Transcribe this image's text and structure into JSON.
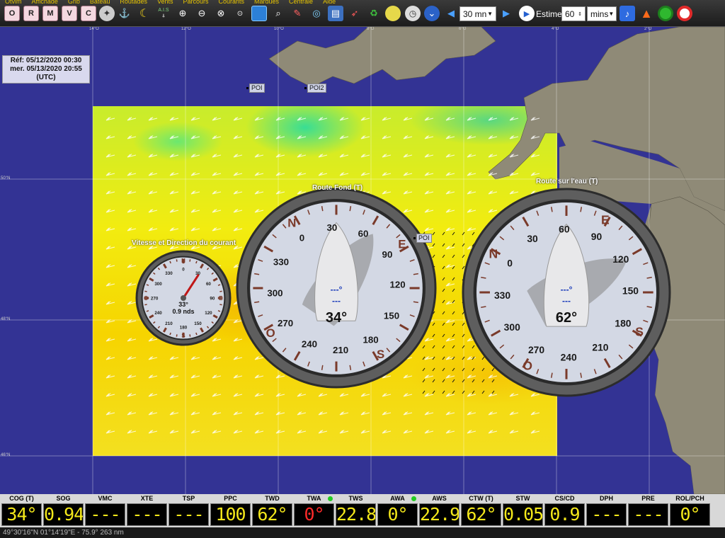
{
  "menu": [
    "Qtvlm",
    "Affichage",
    "Grib",
    "Bateau",
    "Routages",
    "Vents",
    "Parcours",
    "Courants",
    "Marques",
    "Centrale",
    "Aide"
  ],
  "toolbar": {
    "toggles": [
      "O",
      "R",
      "M",
      "V",
      "C"
    ],
    "ais_label": "A.I.S",
    "time_step": "30 mn",
    "estime_label": "Estime",
    "estime_value": "60",
    "estime_unit": "mins"
  },
  "map": {
    "ref_line1": "Réf: 05/12/2020 00:30",
    "ref_line2": "mer. 05/13/2020 20:55",
    "ref_line3": "(UTC)",
    "poi": [
      "POI",
      "POI2",
      "POI"
    ],
    "lat_labels": [
      "50°N",
      "48°N",
      "46°N"
    ],
    "lon_labels": [
      "14°O",
      "12°O",
      "10°O",
      "8°O",
      "6°O",
      "4°O",
      "2°O"
    ]
  },
  "gauges": {
    "current": {
      "title": "Vitesse et Direction du courant",
      "cardinals": [
        "N",
        "E",
        "S",
        "O"
      ],
      "ticks": [
        "0",
        "30",
        "60",
        "90",
        "120",
        "150",
        "180",
        "210",
        "240",
        "270",
        "300",
        "330"
      ],
      "angle_text": "33°",
      "speed_text": "0.9 nds",
      "direction": 33
    },
    "cog": {
      "title": "Route Fond (T)",
      "cardinals": [
        "N",
        "E",
        "S",
        "O"
      ],
      "ticks": [
        "0",
        "30",
        "60",
        "90",
        "120",
        "150",
        "180",
        "210",
        "240",
        "270",
        "300",
        "330"
      ],
      "small1": "---°",
      "small2": "---",
      "value": "34°",
      "heading": 34
    },
    "ctw": {
      "title": "Route sur l'eau (T)",
      "cardinals": [
        "N",
        "E",
        "S",
        "O"
      ],
      "ticks": [
        "0",
        "30",
        "60",
        "90",
        "120",
        "150",
        "180",
        "210",
        "240",
        "270",
        "300",
        "330"
      ],
      "small1": "---°",
      "small2": "---",
      "value": "62°",
      "heading": 62
    }
  },
  "instruments": [
    {
      "label": "COG (T)",
      "value": "34°"
    },
    {
      "label": "SOG",
      "value": "0.94"
    },
    {
      "label": "VMC",
      "value": "----"
    },
    {
      "label": "XTE",
      "value": "----"
    },
    {
      "label": "TSP",
      "value": "----"
    },
    {
      "label": "PPC",
      "value": "100"
    },
    {
      "label": "TWD",
      "value": "62°"
    },
    {
      "label": "TWA",
      "value": "0°",
      "color": "red",
      "dot": true
    },
    {
      "label": "TWS",
      "value": "22.8"
    },
    {
      "label": "AWA",
      "value": "0°",
      "dot": true
    },
    {
      "label": "AWS",
      "value": "22.9"
    },
    {
      "label": "CTW (T)",
      "value": "62°"
    },
    {
      "label": "STW",
      "value": "0.05"
    },
    {
      "label": "CS/CD",
      "value": "0.9"
    },
    {
      "label": "DPH",
      "value": "----"
    },
    {
      "label": "PRE",
      "value": "----"
    },
    {
      "label": "ROL/PCH",
      "value": "0°"
    }
  ],
  "status": "49°30'16\"N 01°14'19\"E - 75.9° 263 nm"
}
